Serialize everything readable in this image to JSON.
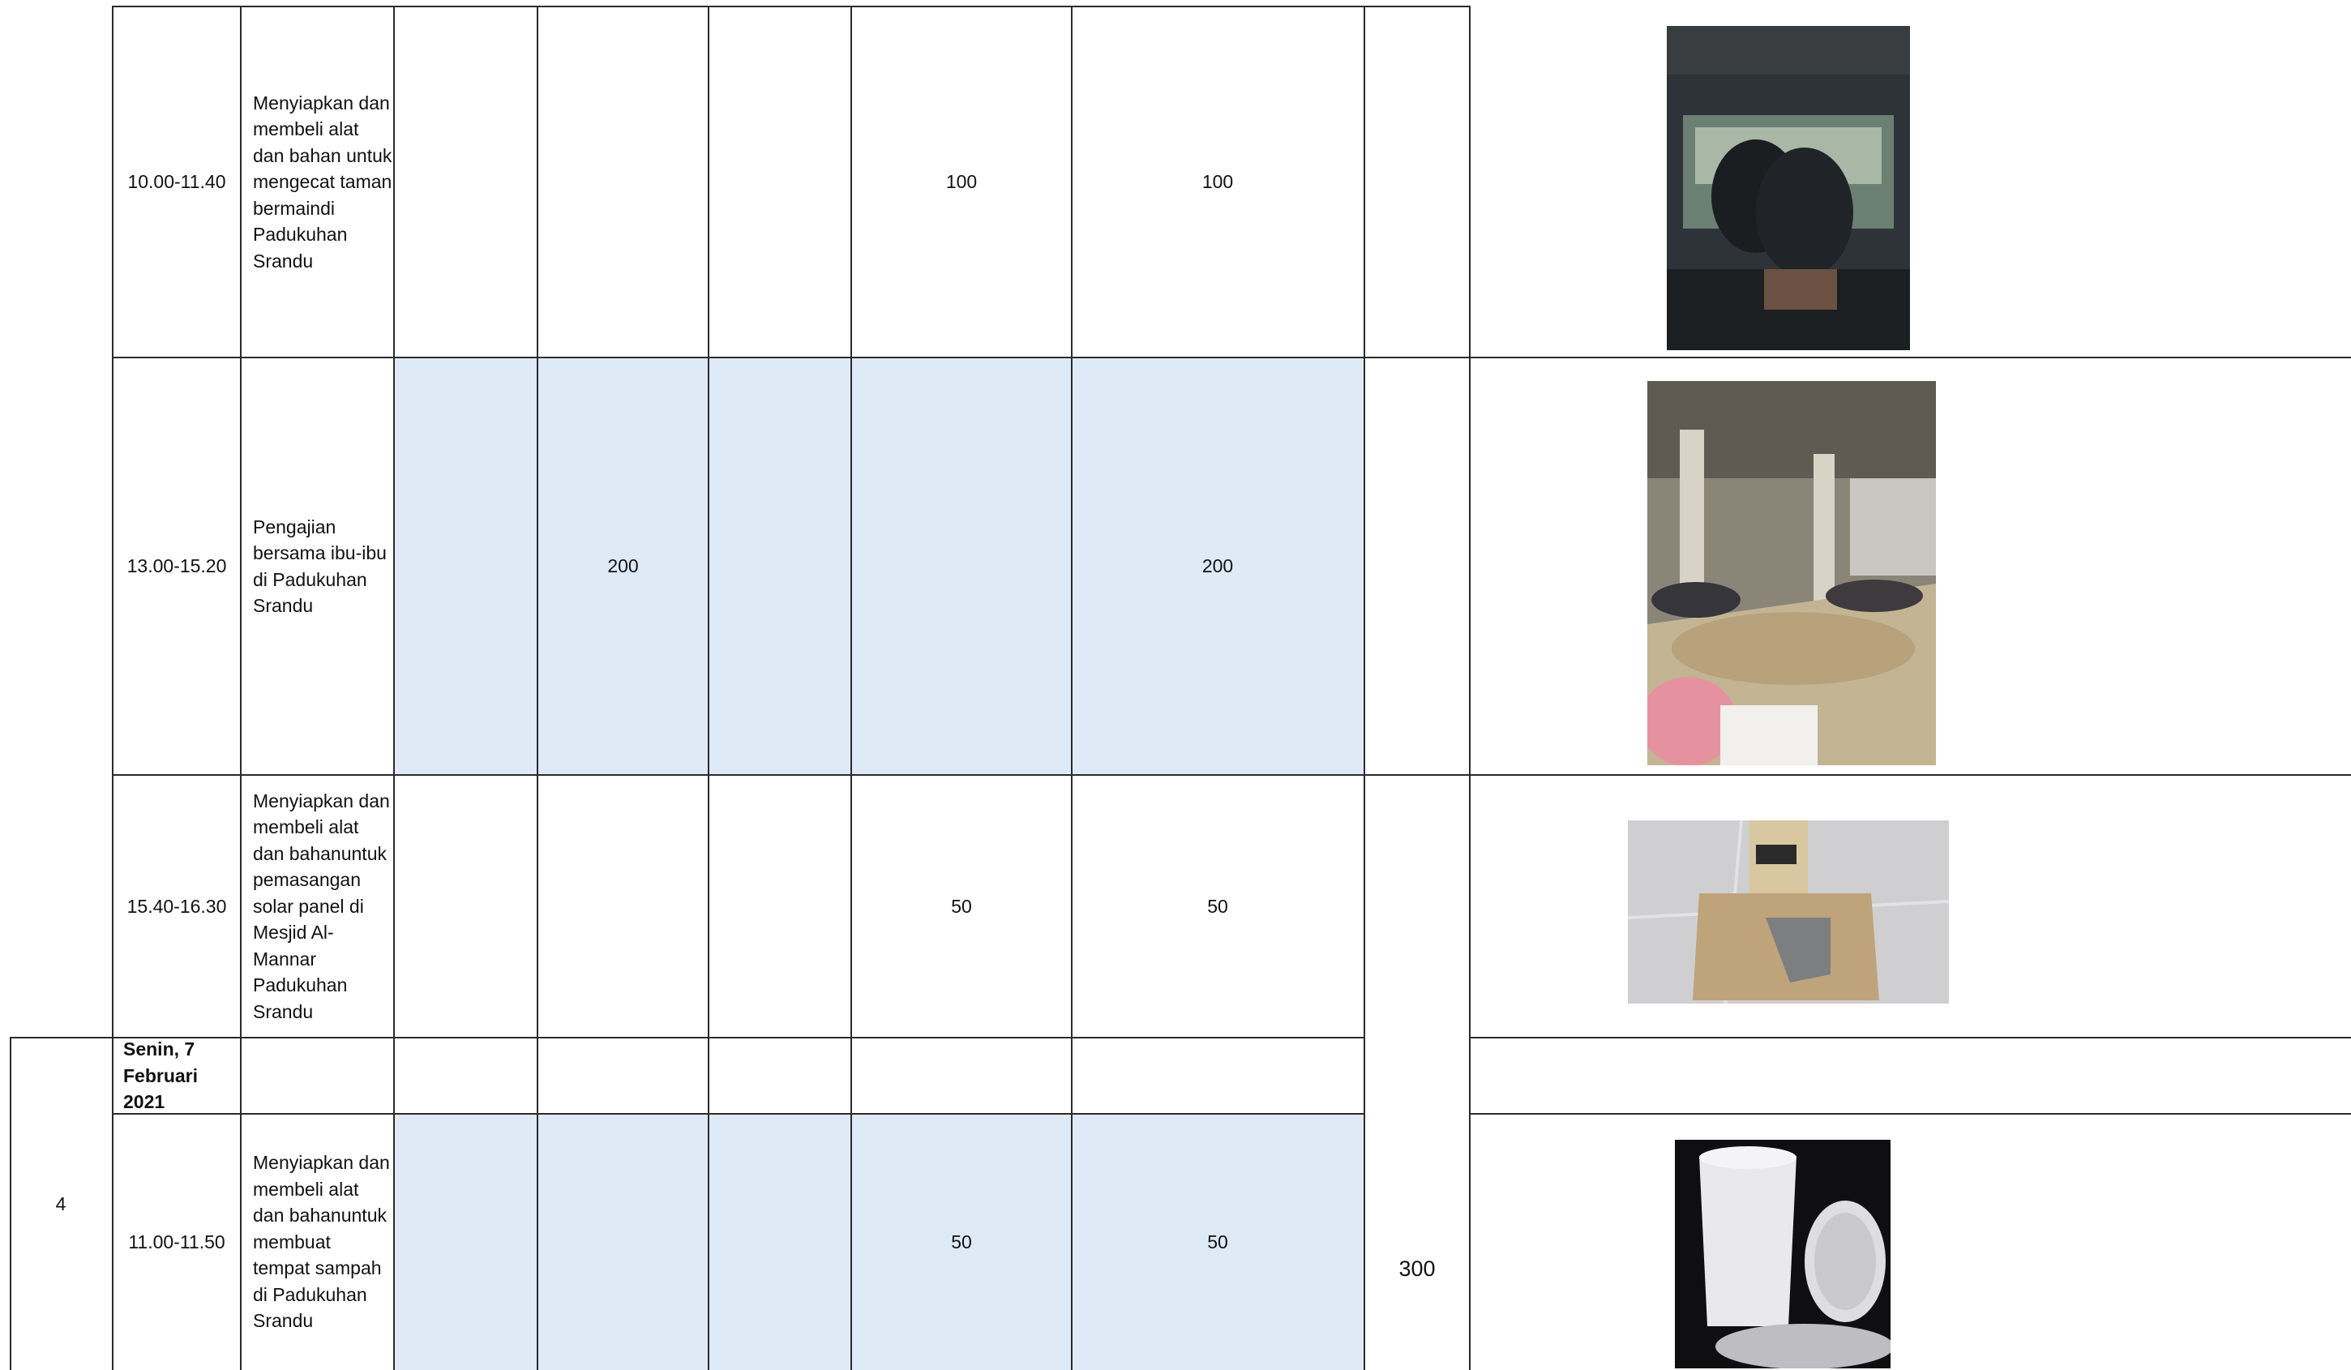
{
  "rows": [
    {
      "time": "10.00-11.40",
      "activity": "Menyiapkan dan membeli alat dan bahan untuk mengecat taman bermaindi Padukuhan Srandu",
      "col6": "100",
      "col7": "100"
    },
    {
      "time": "13.00-15.20",
      "activity": "Pengajian bersama ibu-ibu di Padukuhan Srandu",
      "col4": "200",
      "col7": "200"
    },
    {
      "time": "15.40-16.30",
      "activity": "Menyiapkan dan membeli alat dan bahanuntuk pemasangan solar panel di Mesjid Al-Mannar Padukuhan Srandu",
      "col6": "50",
      "col7": "50"
    },
    {
      "no": "4",
      "date": "Senin, 7 Februari 2021"
    },
    {
      "time": "11.00-11.50",
      "activity": "Menyiapkan dan membeli alat dan bahanuntuk membuat tempat sampah di Padukuhan Srandu",
      "col6": "50",
      "col7": "50"
    }
  ],
  "merged_total": "300",
  "photos": [
    {
      "name": "photo-meeting",
      "colors": [
        "#2d3338",
        "#6b6f64",
        "#1c1f22"
      ]
    },
    {
      "name": "photo-pengajian",
      "colors": [
        "#7d766b",
        "#b9ad96",
        "#d8d2c4"
      ]
    },
    {
      "name": "photo-solar-panel",
      "colors": [
        "#cfcfd1",
        "#bfa37a",
        "#e1e1e3"
      ]
    },
    {
      "name": "photo-bucket",
      "colors": [
        "#0f0f12",
        "#e9e9ec",
        "#bdbdc2"
      ]
    }
  ]
}
